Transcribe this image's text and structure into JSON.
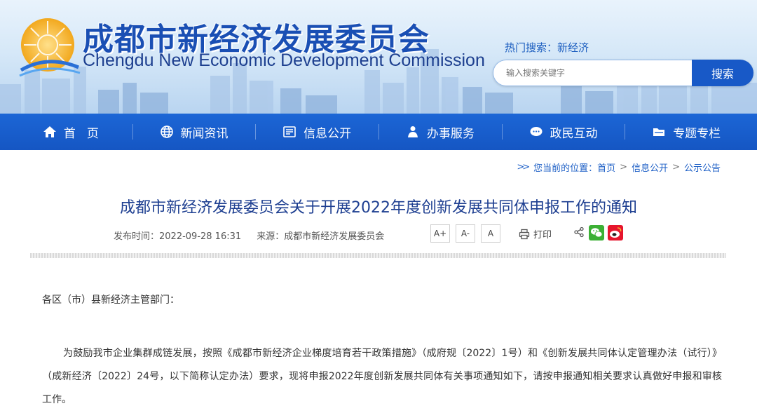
{
  "header": {
    "title_cn": "成都市新经济发展委员会",
    "title_en": "Chengdu New Economic Development Commission",
    "hot_search": "热门搜索：新经济",
    "search_placeholder": "输入搜索关键字",
    "search_button": "搜索"
  },
  "nav": {
    "items": [
      {
        "label": "首页",
        "icon": "home-icon"
      },
      {
        "label": "新闻资讯",
        "icon": "globe-icon"
      },
      {
        "label": "信息公开",
        "icon": "document-icon"
      },
      {
        "label": "办事服务",
        "icon": "person-icon"
      },
      {
        "label": "政民互动",
        "icon": "chat-icon"
      },
      {
        "label": "专题专栏",
        "icon": "folder-icon"
      }
    ]
  },
  "breadcrumb": {
    "prefix": "您当前的位置：",
    "items": [
      "首页",
      "信息公开",
      "公示公告"
    ]
  },
  "article": {
    "title": "成都市新经济发展委员会关于开展2022年度创新发展共同体申报工作的通知",
    "publish_time": "发布时间：2022-09-28 16:31",
    "source": "来源：成都市新经济发展委员会",
    "font_larger": "A+",
    "font_smaller": "A-",
    "font_default": "A",
    "print_label": "打印",
    "salutation": "各区（市）县新经济主管部门：",
    "paragraph": "为鼓励我市企业集群成链发展，按照《成都市新经济企业梯度培育若干政策措施》（成府规〔2022〕1号）和《创新发展共同体认定管理办法（试行）》（成新经济〔2022〕24号，以下简称认定办法）要求，现将申报2022年度创新发展共同体有关事项通知如下，请按申报通知相关要求认真做好申报和审核工作。"
  },
  "colors": {
    "primary": "#1859c7",
    "nav": "#1c66d6",
    "title": "#1e3f91",
    "logo_gold": "#f2a81d"
  }
}
